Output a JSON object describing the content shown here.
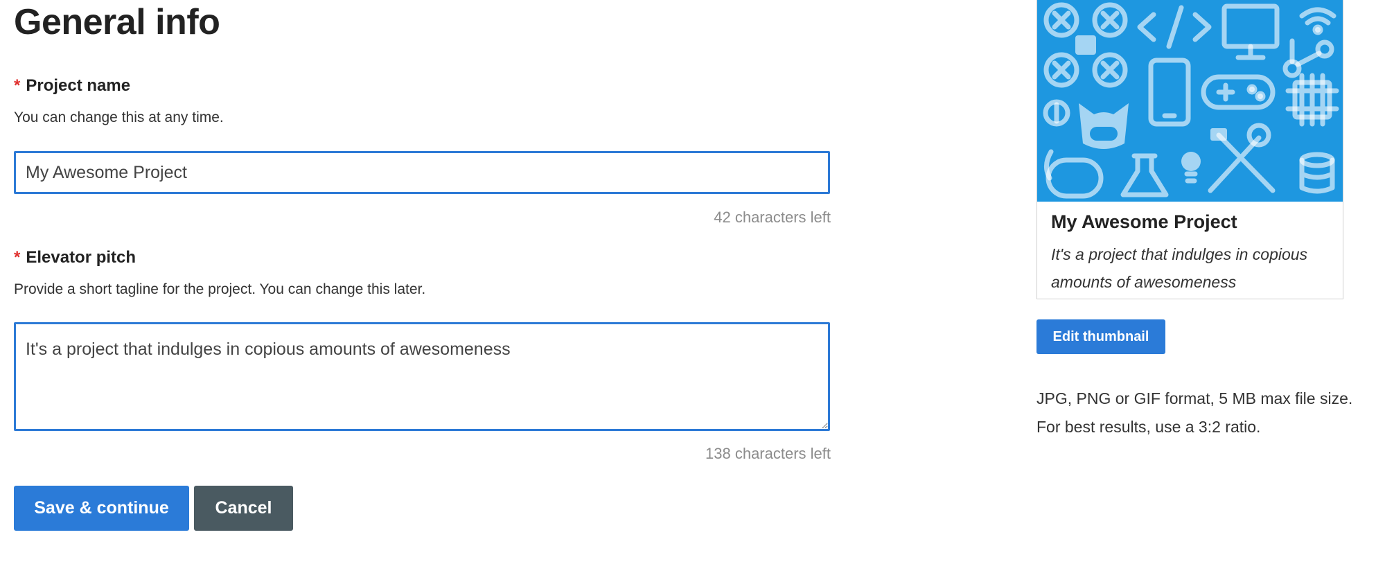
{
  "page": {
    "title": "General info"
  },
  "project_name": {
    "label": "Project name",
    "required_marker": "*",
    "help": "You can change this at any time.",
    "value": "My Awesome Project",
    "counter": "42 characters left"
  },
  "elevator_pitch": {
    "label": "Elevator pitch",
    "required_marker": "*",
    "help": "Provide a short tagline for the project. You can change this later.",
    "value": "It's a project that indulges in copious amounts of awesomeness",
    "counter": "138 characters left"
  },
  "actions": {
    "save_label": "Save & continue",
    "cancel_label": "Cancel"
  },
  "preview": {
    "title": "My Awesome Project",
    "pitch": "It's a project that indulges in copious amounts of awesomeness",
    "thumbnail_icons": [
      "drone-icon",
      "code-icon",
      "monitor-icon",
      "wifi-icon",
      "phone-icon",
      "gamepad-icon",
      "chip-icon",
      "dollar-icon",
      "octocat-icon",
      "mouse-icon",
      "flask-icon",
      "lightbulb-icon",
      "tools-icon",
      "database-icon"
    ],
    "edit_label": "Edit thumbnail",
    "file_note": "JPG, PNG or GIF format, 5 MB max file size. For best results, use a 3:2 ratio."
  },
  "colors": {
    "accent": "#2b7bd8",
    "cancel": "#4a5a61",
    "required": "#e0312f",
    "thumbnail_bg": "#1e97e0"
  }
}
